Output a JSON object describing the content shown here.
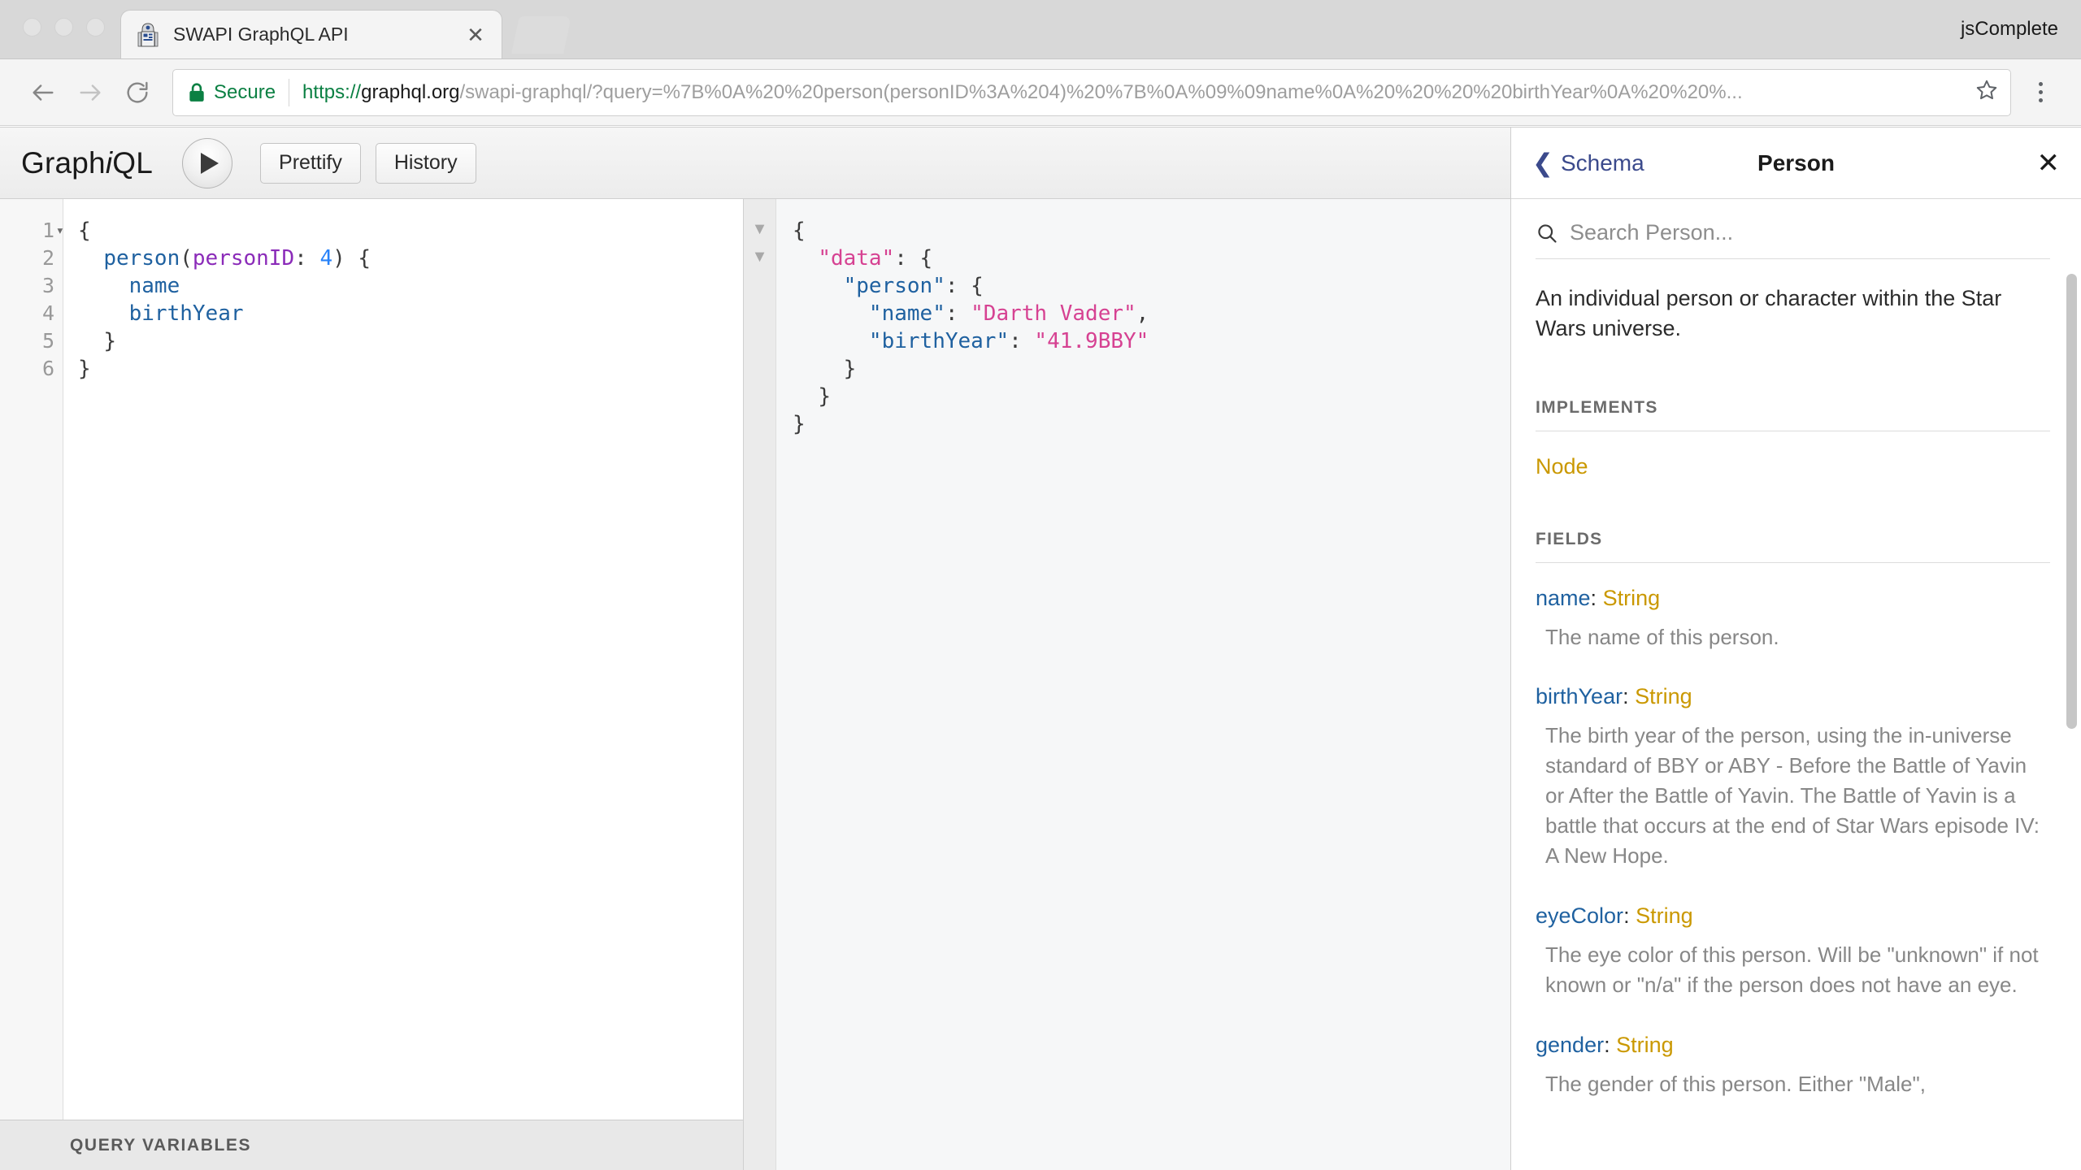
{
  "browser": {
    "profile_name": "jsComplete",
    "tab": {
      "title": "SWAPI GraphQL API",
      "favicon_name": "r2d2-favicon",
      "close_label": "✕"
    },
    "omnibox": {
      "secure_label": "Secure",
      "url_protocol": "https://",
      "url_host": "graphql.org",
      "url_path": "/swapi-graphql/?query=%7B%0A%20%20person(personID%3A%204)%20%7B%0A%09%09name%0A%20%20%20%20birthYear%0A%20%20%...",
      "url_full": "https://graphql.org/swapi-graphql/?query=%7B%0A%20%20person(personID%3A%204)%20%7B%0A%09%09name%0A%20%20%20%20birthYear%0A%20%20%..."
    }
  },
  "graphiql": {
    "logo_pre": "Graph",
    "logo_i": "i",
    "logo_post": "QL",
    "execute_label": "▶",
    "prettify_label": "Prettify",
    "history_label": "History",
    "query_variables_label": "QUERY VARIABLES",
    "editor": {
      "line_numbers": [
        "1",
        "2",
        "3",
        "4",
        "5",
        "6"
      ],
      "lines": [
        "{",
        "  person(personID: 4) {",
        "    name",
        "    birthYear",
        "  }",
        "}"
      ],
      "tokens": {
        "operation": "person",
        "argument": "personID",
        "argument_value": "4",
        "field_1": "name",
        "field_2": "birthYear"
      }
    },
    "result": {
      "lines": [
        "{",
        "  \"data\": {",
        "    \"person\": {",
        "      \"name\": \"Darth Vader\",",
        "      \"birthYear\": \"41.9BBY\"",
        "    }",
        "  }",
        "}"
      ],
      "keys": {
        "data": "\"data\"",
        "person": "\"person\"",
        "name": "\"name\"",
        "birthYear": "\"birthYear\""
      },
      "values": {
        "name": "\"Darth Vader\"",
        "birthYear": "\"41.9BBY\""
      }
    }
  },
  "docs": {
    "back_label": "Schema",
    "title": "Person",
    "close_label": "✕",
    "search_placeholder": "Search Person...",
    "search_value": "",
    "type_description": "An individual person or character within the Star Wars universe.",
    "implements_heading": "IMPLEMENTS",
    "implements": [
      {
        "name": "Node"
      }
    ],
    "fields_heading": "FIELDS",
    "fields": [
      {
        "name": "name",
        "type": "String",
        "description": "The name of this person."
      },
      {
        "name": "birthYear",
        "type": "String",
        "description": "The birth year of the person, using the in-universe standard of BBY or ABY - Before the Battle of Yavin or After the Battle of Yavin. The Battle of Yavin is a battle that occurs at the end of Star Wars episode IV: A New Hope."
      },
      {
        "name": "eyeColor",
        "type": "String",
        "description": "The eye color of this person. Will be \"unknown\" if not known or \"n/a\" if the person does not have an eye."
      },
      {
        "name": "gender",
        "type": "String",
        "description": "The gender of this person. Either \"Male\","
      }
    ]
  },
  "colors": {
    "secure_green": "#0b8043",
    "graphql_field_blue": "#1f61a0",
    "graphql_arg_purple": "#8b2bb9",
    "graphql_number_blue": "#2882f9",
    "graphql_string_pink": "#d64292",
    "docs_type_orange": "#ca9800",
    "docs_link_blue": "#3b4a8c"
  }
}
